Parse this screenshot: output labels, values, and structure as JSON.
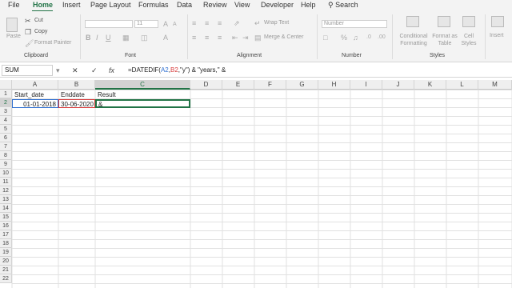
{
  "menu": [
    "File",
    "Home",
    "Insert",
    "Page Layout",
    "Formulas",
    "Data",
    "Review",
    "View",
    "Developer",
    "Help"
  ],
  "search_label": "Search",
  "ribbon": {
    "paste": "Paste",
    "cut": "Cut",
    "copy": "Copy",
    "format_painter": "Format Painter",
    "clipboard": "Clipboard",
    "font": "Font",
    "font_size": "11",
    "alignment": "Alignment",
    "wrap_text": "Wrap Text",
    "merge_center": "Merge & Center",
    "number_format": "Number",
    "number": "Number",
    "conditional_formatting": "Conditional Formatting",
    "format_as_table": "Format as Table",
    "cell_styles": "Cell Styles",
    "styles": "Styles",
    "insert": "Insert"
  },
  "name_box": "SUM",
  "formula_parts": [
    "=DATEDIF(",
    "A2",
    ",",
    "B2",
    ",\"y\") & \"years,\" &"
  ],
  "columns": [
    "A",
    "B",
    "C",
    "D",
    "E",
    "F",
    "G",
    "H",
    "I",
    "J",
    "K",
    "L",
    "M"
  ],
  "rows": [
    "1",
    "2",
    "3",
    "4",
    "5",
    "6",
    "7",
    "8",
    "9",
    "10",
    "11",
    "12",
    "13",
    "14",
    "15",
    "16",
    "17",
    "18",
    "19",
    "20",
    "21",
    "22"
  ],
  "cells": {
    "a1": "Start_date",
    "b1": "Enddate",
    "c1": "Result",
    "a2": "01-01-2018",
    "b2": "30-06-2020",
    "c2": "&"
  },
  "colors": {
    "accent": "#217346",
    "ref_a2": "#2f6fd0",
    "ref_b2": "#d83b3b"
  }
}
